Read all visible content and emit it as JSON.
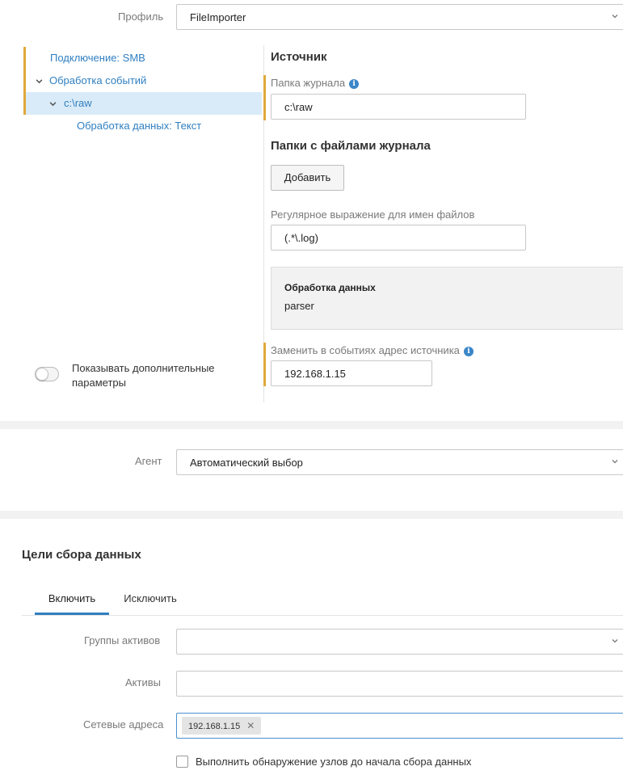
{
  "profile": {
    "label": "Профиль",
    "value": "FileImporter"
  },
  "tree": {
    "items": [
      {
        "label": "Подключение: SMB"
      },
      {
        "label": "Обработка событий"
      },
      {
        "label": "c:\\raw"
      },
      {
        "label": "Обработка данных: Текст"
      }
    ]
  },
  "toggle": {
    "label": "Показывать дополнительные параметры",
    "line1": "Показывать дополнительные",
    "line2": "параметры"
  },
  "source": {
    "title": "Источник",
    "log_folder_label": "Папка журнала",
    "log_folder_value": "c:\\raw",
    "folders_title": "Папки с файлами журнала",
    "add_button": "Добавить",
    "regex_label": "Регулярное выражение для имен файлов",
    "regex_value": "(.*\\.log)",
    "processing_title": "Обработка данных",
    "processing_value": "parser",
    "replace_label": "Заменить в событиях адрес источника",
    "replace_value": "192.168.1.15"
  },
  "agent": {
    "label": "Агент",
    "value": "Автоматический выбор"
  },
  "targets": {
    "title": "Цели сбора данных",
    "tabs": [
      {
        "label": "Включить"
      },
      {
        "label": "Исключить"
      }
    ],
    "asset_groups_label": "Группы активов",
    "assets_label": "Активы",
    "network_label": "Сетевые адреса",
    "network_chip": "192.168.1.15",
    "discovery_label": "Выполнить обнаружение узлов до начала сбора данных"
  },
  "colors": {
    "accent": "#2f7fc1",
    "marker": "#e0a93b",
    "selected_bg": "#d9ebf8",
    "info": "#3a86c8"
  }
}
